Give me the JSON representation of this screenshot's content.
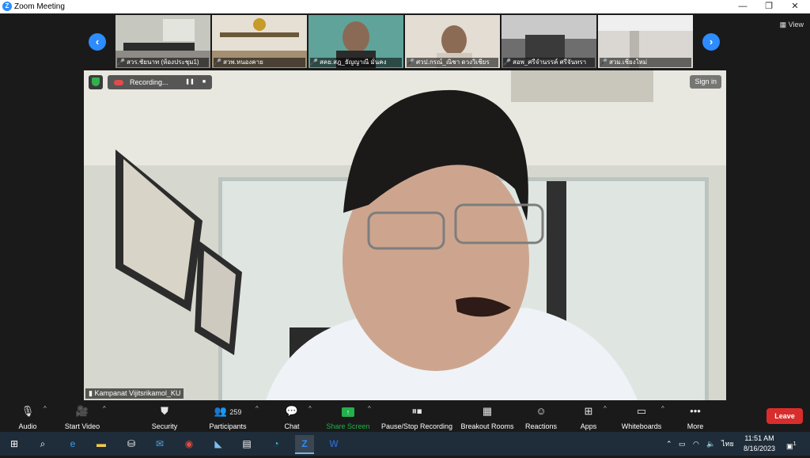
{
  "window": {
    "app_icon": "zoom-logo-icon",
    "title": "Zoom Meeting",
    "minimize": "—",
    "restore": "❐",
    "close": "✕"
  },
  "gallery": {
    "prev_icon": "chevron-left-icon",
    "next_icon": "chevron-right-icon",
    "view_label": "View",
    "participants": [
      {
        "name": "สวร.ชัยนาท (ห้องประชุม1)",
        "muted": true
      },
      {
        "name": "สวพ.หนองคาย",
        "muted": true
      },
      {
        "name": "สคย.สฎ_ธัญญาณี มั่นคง",
        "muted": true
      },
      {
        "name": "ศวป.กรณ์_ณิชา ดวงวิเชียร",
        "muted": true
      },
      {
        "name": "สอพ_ศรีจำนรรค์ ศรีจันทรา",
        "muted": true
      },
      {
        "name": "สวม.เชียงใหม่",
        "muted": true
      }
    ]
  },
  "main": {
    "recording_label": "Recording...",
    "pause_icon": "pause-icon",
    "stop_icon": "stop-icon",
    "sign_in": "Sign in",
    "speaker_name": "Kampanat Vijitsrikamol_KU"
  },
  "toolbar": {
    "audio": "Audio",
    "start_video": "Start Video",
    "security": "Security",
    "participants": "Participants",
    "participants_count": "259",
    "chat": "Chat",
    "share_screen": "Share Screen",
    "pause_stop_recording": "Pause/Stop Recording",
    "breakout_rooms": "Breakout Rooms",
    "reactions": "Reactions",
    "apps": "Apps",
    "whiteboards": "Whiteboards",
    "more": "More",
    "leave": "Leave",
    "share_color": "#22b14c",
    "leave_color": "#d92d2d"
  },
  "taskbar": {
    "time": "11:51 AM",
    "date": "8/16/2023",
    "lang": "ไทย",
    "notification_count": "1"
  }
}
